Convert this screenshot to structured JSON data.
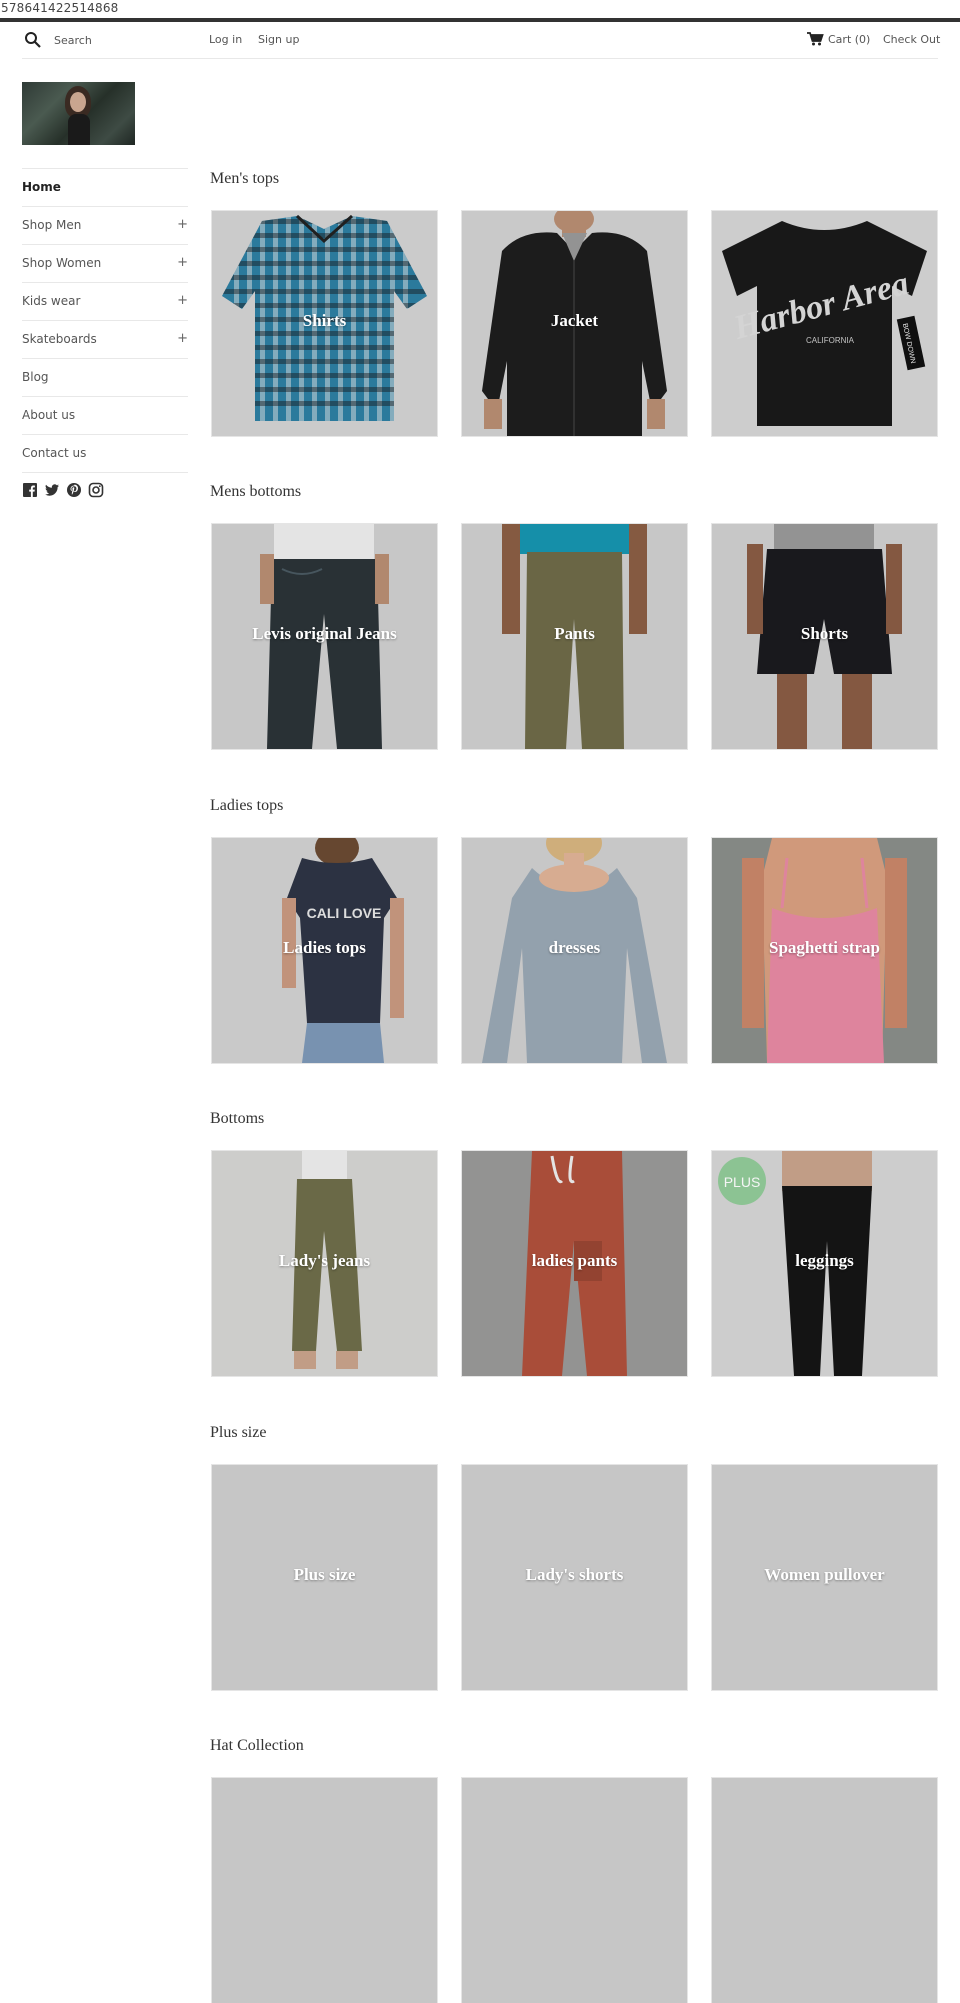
{
  "page_id_text": "578641422514868",
  "topnav": {
    "search_placeholder": "Search",
    "login": "Log in",
    "signup": "Sign up",
    "cart": "Cart (0)",
    "checkout": "Check Out"
  },
  "sidebar": {
    "items": [
      {
        "label": "Home",
        "active": true,
        "expandable": false
      },
      {
        "label": "Shop Men",
        "expandable": true
      },
      {
        "label": "Shop Women",
        "expandable": true
      },
      {
        "label": "Kids wear",
        "expandable": true
      },
      {
        "label": "Skateboards",
        "expandable": true
      },
      {
        "label": "Blog",
        "expandable": false
      },
      {
        "label": "About us",
        "expandable": false
      },
      {
        "label": "Contact us",
        "expandable": false
      }
    ],
    "expand_symbol": "+",
    "social_icons": [
      "facebook-icon",
      "twitter-icon",
      "pinterest-icon",
      "instagram-icon"
    ]
  },
  "sections": [
    {
      "title": "Men's tops",
      "tiles": [
        "Shirts",
        "Jacket",
        ""
      ]
    },
    {
      "title": "Mens bottoms",
      "tiles": [
        "Levis original Jeans",
        "Pants",
        "Shorts"
      ]
    },
    {
      "title": "Ladies tops",
      "tiles": [
        "Ladies tops",
        "dresses",
        "Spaghetti strap"
      ]
    },
    {
      "title": "Bottoms",
      "tiles": [
        "Lady's jeans",
        "ladies pants",
        "leggings"
      ]
    },
    {
      "title": "Plus size",
      "tiles": [
        "Plus size",
        "Lady's shorts",
        "Women pullover"
      ]
    },
    {
      "title": "Hat Collection",
      "tiles": [
        "",
        "",
        ""
      ]
    }
  ],
  "product_art_text": {
    "tshirt_script": "Harbor Area",
    "tshirt_sub": "CALIFORNIA",
    "tag": "BOW DOWN",
    "cali": "CALI LOVE",
    "plus_badge": "PLUS"
  },
  "colors": {
    "tile_placeholder": "#cfcfcf",
    "text": "#333333",
    "topbar_border": "#333333"
  }
}
